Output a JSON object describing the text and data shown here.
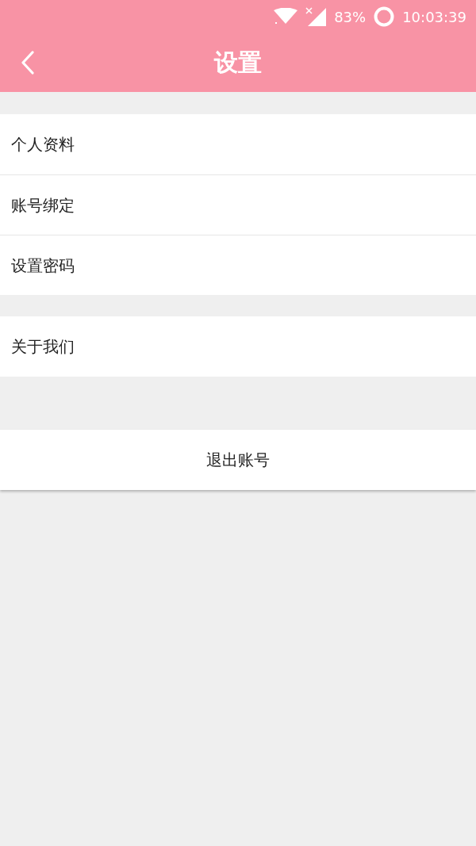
{
  "status_bar": {
    "battery": "83%",
    "time": "10:03:39"
  },
  "header": {
    "title": "设置"
  },
  "groups": [
    {
      "items": [
        {
          "label": "个人资料"
        },
        {
          "label": "账号绑定"
        },
        {
          "label": "设置密码"
        }
      ]
    },
    {
      "items": [
        {
          "label": "关于我们"
        }
      ]
    }
  ],
  "logout_button": {
    "label": "退出账号"
  }
}
